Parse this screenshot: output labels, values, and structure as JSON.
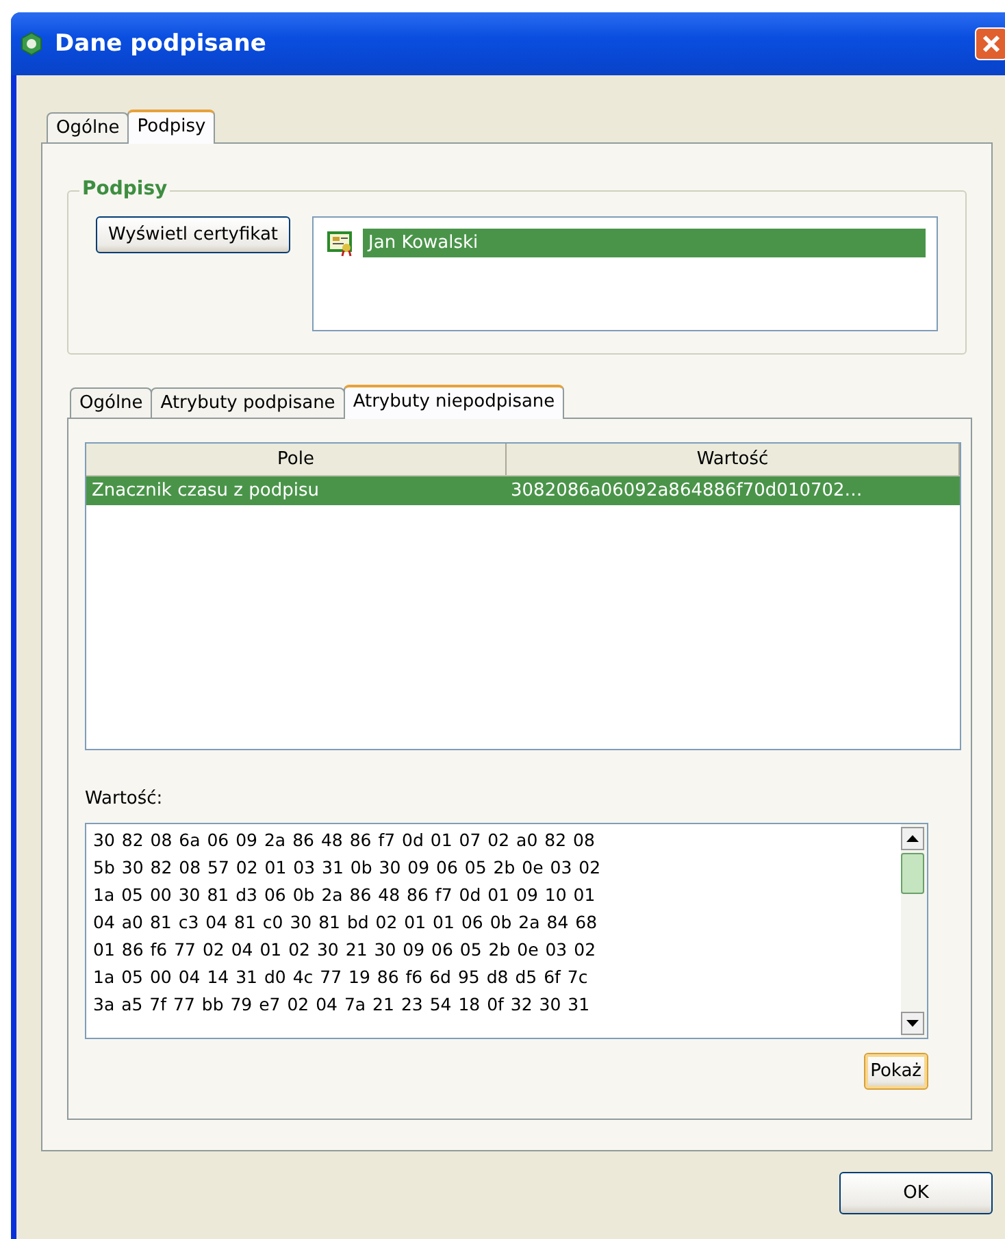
{
  "window": {
    "title": "Dane podpisane"
  },
  "tabs": [
    {
      "label": "Ogólne",
      "selected": false
    },
    {
      "label": "Podpisy",
      "selected": true
    }
  ],
  "signatures_group": {
    "title": "Podpisy",
    "button": "Wyświetl certyfikat",
    "signers": [
      {
        "name": "Jan Kowalski",
        "selected": true
      }
    ]
  },
  "detail_tabs": [
    {
      "label": "Ogólne",
      "selected": false
    },
    {
      "label": "Atrybuty podpisane",
      "selected": false
    },
    {
      "label": "Atrybuty niepodpisane",
      "selected": true
    }
  ],
  "table": {
    "columns": [
      "Pole",
      "Wartość"
    ],
    "rows": [
      {
        "cells": [
          "Znacznik czasu z podpisu",
          "3082086a06092a864886f70d010702…"
        ],
        "selected": true
      }
    ]
  },
  "value_label": "Wartość:",
  "value_lines": [
    "30 82 08 6a 06 09 2a 86 48 86 f7 0d 01 07 02 a0 82 08",
    "5b 30 82 08 57 02 01 03 31 0b 30 09 06 05 2b 0e 03 02",
    "1a 05 00 30 81 d3 06 0b 2a 86 48 86 f7 0d 01 09 10 01",
    "04 a0 81 c3 04 81 c0 30 81 bd 02 01 01 06 0b 2a 84 68",
    "01 86 f6 77 02 04 01 02 30 21 30 09 06 05 2b 0e 03 02",
    "1a 05 00 04 14 31 d0 4c 77 19 86 f6 6d 95 d8 d5 6f 7c",
    "3a a5 7f 77 bb 79 e7 02 04 7a 21 23 54 18 0f 32 30 31"
  ],
  "show_button": "Pokaż",
  "ok_button": "OK"
}
